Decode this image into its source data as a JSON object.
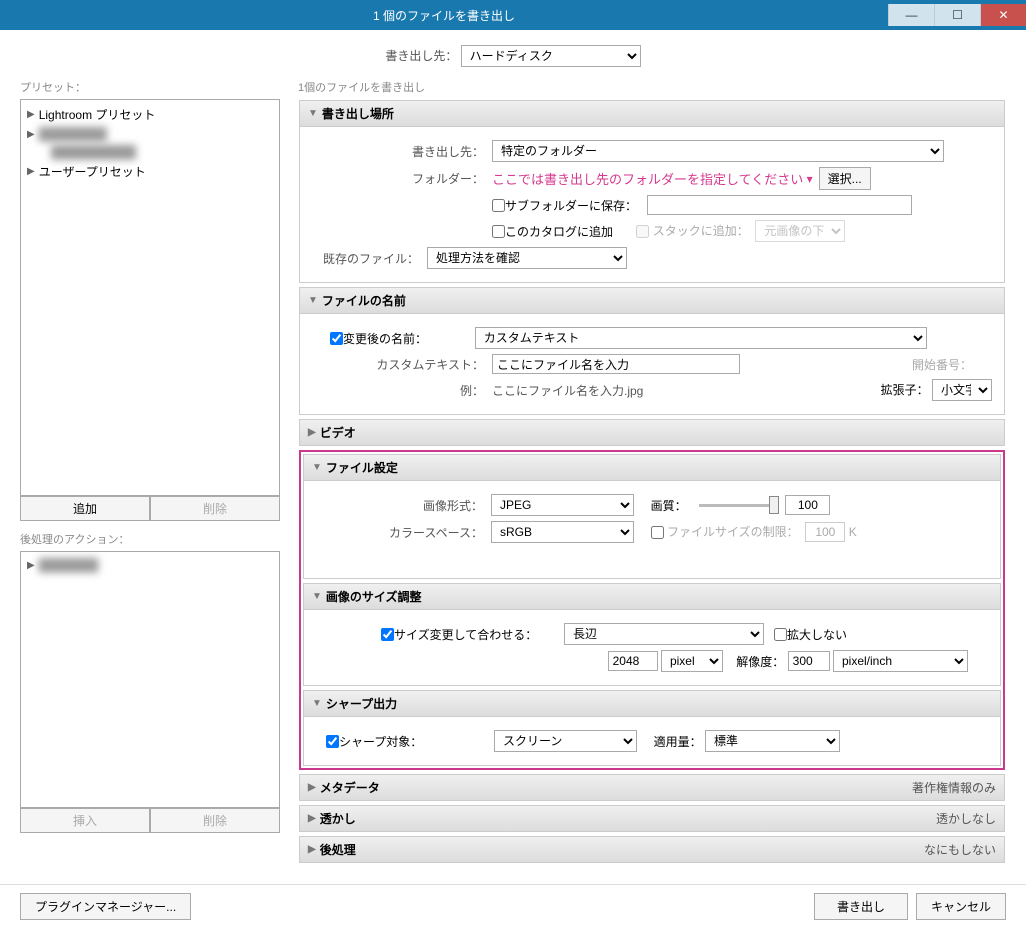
{
  "titlebar": {
    "title": "1 個のファイルを書き出し"
  },
  "export_to": {
    "label": "書き出し先：",
    "value": "ハードディスク"
  },
  "presets": {
    "label": "プリセット：",
    "items": [
      "Lightroom プリセット",
      "",
      "",
      "ユーザープリセット"
    ],
    "add_btn": "追加",
    "remove_btn": "削除"
  },
  "postactions": {
    "label": "後処理のアクション：",
    "insert_btn": "挿入",
    "remove_btn": "削除"
  },
  "right_header": "1個のファイルを書き出し",
  "location": {
    "title": "書き出し場所",
    "export_to_label": "書き出し先：",
    "export_to_value": "特定のフォルダー",
    "folder_label": "フォルダー：",
    "folder_text": "ここでは書き出し先のフォルダーを指定してください",
    "choose_btn": "選択...",
    "subfolder_check": "サブフォルダーに保存：",
    "catalog_check": "このカタログに追加",
    "stack_check": "スタックに追加：",
    "stack_value": "元画像の下",
    "existing_label": "既存のファイル：",
    "existing_value": "処理方法を確認"
  },
  "naming": {
    "title": "ファイルの名前",
    "rename_check": "変更後の名前：",
    "template_value": "カスタムテキスト",
    "custom_text_label": "カスタムテキスト：",
    "custom_text_value": "ここにファイル名を入力",
    "start_num_label": "開始番号：",
    "example_label": "例：",
    "example_value": "ここにファイル名を入力.jpg",
    "ext_label": "拡張子：",
    "ext_value": "小文字"
  },
  "video": {
    "title": "ビデオ"
  },
  "filesettings": {
    "title": "ファイル設定",
    "format_label": "画像形式：",
    "format_value": "JPEG",
    "quality_label": "画質：",
    "quality_value": "100",
    "colorspace_label": "カラースペース：",
    "colorspace_value": "sRGB",
    "limit_check": "ファイルサイズの制限：",
    "limit_value": "100",
    "limit_unit": "K"
  },
  "sizing": {
    "title": "画像のサイズ調整",
    "resize_check": "サイズ変更して合わせる：",
    "fit_value": "長辺",
    "dont_enlarge": "拡大しない",
    "size_value": "2048",
    "size_unit": "pixel",
    "resolution_label": "解像度：",
    "resolution_value": "300",
    "resolution_unit": "pixel/inch"
  },
  "sharpen": {
    "title": "シャープ出力",
    "sharpen_check": "シャープ対象：",
    "sharpen_value": "スクリーン",
    "amount_label": "適用量：",
    "amount_value": "標準"
  },
  "metadata": {
    "title": "メタデータ",
    "summary": "著作権情報のみ"
  },
  "watermark": {
    "title": "透かし",
    "summary": "透かしなし"
  },
  "postprocess": {
    "title": "後処理",
    "summary": "なにもしない"
  },
  "footer": {
    "plugin_mgr": "プラグインマネージャー...",
    "export": "書き出し",
    "cancel": "キャンセル"
  }
}
